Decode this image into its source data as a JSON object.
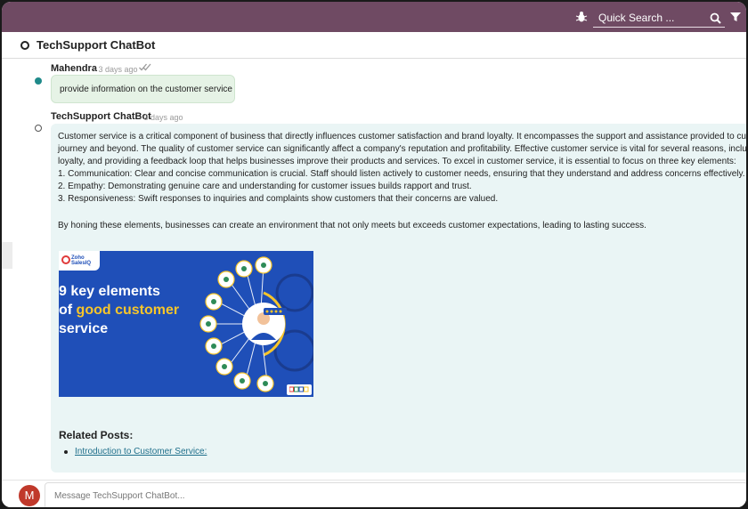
{
  "topbar": {
    "search_placeholder": "Quick Search ...",
    "icons": [
      "bug-icon",
      "search-icon",
      "filter-icon"
    ],
    "color": "#6f4a63"
  },
  "channel": {
    "title": "TechSupport ChatBot"
  },
  "messages": [
    {
      "author": "Mahendra",
      "time": "- 3 days ago",
      "text": "provide information on the customer service",
      "status_icon": "double-check-icon"
    },
    {
      "author": "TechSupport ChatBot",
      "time": "- 3 days ago",
      "lines": [
        "Customer service is a critical component of business that directly influences customer satisfaction and brand loyalty. It encompasses the support and assistance provided to customers",
        "journey and beyond. The quality of customer service can significantly affect a company's reputation and profitability. Effective customer service is vital for several reasons, including cu",
        "loyalty, and providing a feedback loop that helps businesses improve their products and services. To excel in customer service, it is essential to focus on three key elements:",
        "1. Communication: Clear and concise communication is crucial. Staff should listen actively to customer needs, ensuring that they understand and address concerns effectively.",
        "2. Empathy: Demonstrating genuine care and understanding for customer issues builds rapport and trust.",
        "3. Responsiveness: Swift responses to inquiries and complaints show customers that their concerns are valued."
      ],
      "closing": "By honing these elements, businesses can create an environment that not only meets but exceeds customer expectations, leading to lasting success.",
      "image": {
        "tag_line1": "Zoho",
        "tag_line2": "SalesIQ",
        "line1": "9 key elements",
        "line2_plain": "of ",
        "line2_highlight": "good customer",
        "line3": "service",
        "brand_color": "#1f4fb8",
        "highlight_color": "#f7c52a"
      },
      "related_title": "Related Posts:",
      "related_links": [
        "Introduction to Customer Service:"
      ]
    }
  ],
  "composer": {
    "avatar_letter": "M",
    "placeholder": "Message TechSupport ChatBot..."
  }
}
